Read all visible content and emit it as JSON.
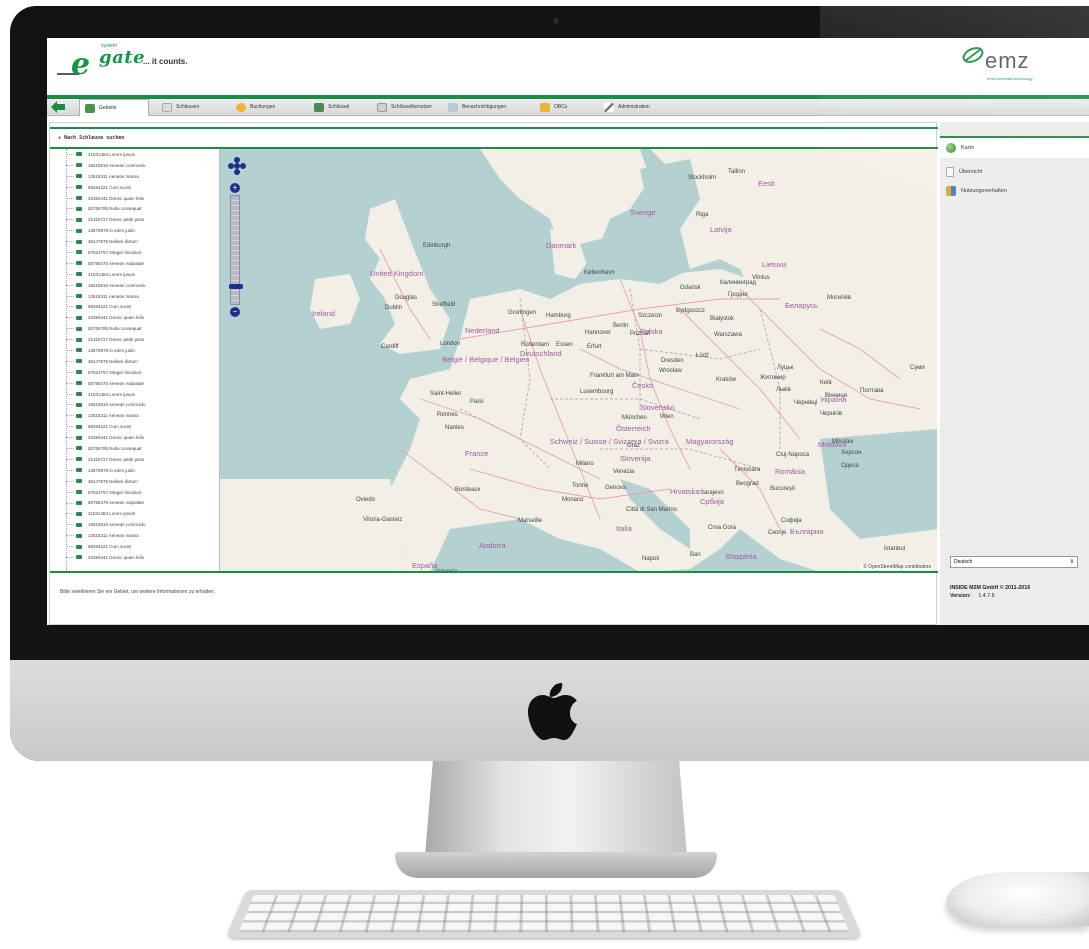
{
  "header": {
    "logo_left_prefix": "e",
    "logo_left_word": "gate",
    "logo_left_small": "system",
    "logo_left_tagline": "... it counts.",
    "logo_right": "emz",
    "logo_right_sub": "environmental technology"
  },
  "tabs": [
    {
      "label": "Gebiete",
      "icon": "map-icon",
      "active": true
    },
    {
      "label": "Schleusen",
      "icon": "gate-icon",
      "active": false
    },
    {
      "label": "Buchungen",
      "icon": "coins-icon",
      "active": false
    },
    {
      "label": "Schlüssel",
      "icon": "key-card-icon",
      "active": false
    },
    {
      "label": "Schlüsselbenutzer",
      "icon": "user-card-icon",
      "active": false
    },
    {
      "label": "Benachrichtigungen",
      "icon": "notification-icon",
      "active": false
    },
    {
      "label": "OBCs",
      "icon": "obc-icon",
      "active": false
    },
    {
      "label": "Administration",
      "icon": "wrench-icon",
      "active": false
    }
  ],
  "panel": {
    "title": "+ Nach Schleuse suchen",
    "status_message": "Bitte selektieren Sie ein Gebiet, um weitere Informationen zu erhalten."
  },
  "list": [
    "21531484 Lorem ipsum",
    "16515515 Aenean commodo",
    "13515311 Aenean massa",
    "89454221 Cum sociis",
    "34384441 Donec quam felis",
    "53755785 Nulla consequat",
    "21315727 Donec pede justo",
    "13575978 In enim justo",
    "35447875 Nullam dictum",
    "87524757 Integer tincidunt",
    "58785475 Aenean vulputate",
    "21531484 Lorem ipsum",
    "16515515 Aenean commodo",
    "13515311 Aenean massa",
    "89454221 Cum sociis",
    "34384441 Donec quam felis",
    "53755785 Nulla consequat",
    "21315727 Donec pede justo",
    "13575978 In enim justo",
    "35447875 Nullam dictum",
    "87524757 Integer tincidunt",
    "58785475 Aenean vulputate",
    "21531484 Lorem ipsum",
    "16515515 Aenean commodo",
    "13515311 Aenean massa",
    "89454221 Cum sociis",
    "34384441 Donec quam felis",
    "53755785 Nulla consequat",
    "21315727 Donec pede justo",
    "13575978 In enim justo",
    "35447875 Nullam dictum",
    "87524757 Integer tincidunt",
    "58785475 Aenean vulputate",
    "21531484 Lorem ipsum",
    "16515515 Aenean commodo",
    "13515311 Aenean massa",
    "89454221 Cum sociis",
    "34384441 Donec quam felis"
  ],
  "map": {
    "attribution": "© OpenStreetMap contributors",
    "countries": [
      {
        "name": "United Kingdom"
      },
      {
        "name": "Ireland"
      },
      {
        "name": "Danmark"
      },
      {
        "name": "Nederland"
      },
      {
        "name": "België / Belgique / Belgien"
      },
      {
        "name": "Deutschland"
      },
      {
        "name": "Polska"
      },
      {
        "name": "Česko"
      },
      {
        "name": "Slovensko"
      },
      {
        "name": "Österreich"
      },
      {
        "name": "Schweiz / Suisse / Svizzera / Svizra"
      },
      {
        "name": "France"
      },
      {
        "name": "Italia"
      },
      {
        "name": "Magyarország"
      },
      {
        "name": "România"
      },
      {
        "name": "Lietuva"
      },
      {
        "name": "Latvija"
      },
      {
        "name": "Eesti"
      },
      {
        "name": "Беларусь"
      },
      {
        "name": "Україна"
      },
      {
        "name": "Moldova"
      },
      {
        "name": "Slovenija"
      },
      {
        "name": "Hrvatska"
      },
      {
        "name": "Србија"
      },
      {
        "name": "България"
      },
      {
        "name": "Sverige"
      },
      {
        "name": "España"
      },
      {
        "name": "Shqipëria"
      },
      {
        "name": "Andorra"
      }
    ],
    "cities": [
      {
        "name": "Edinburgh"
      },
      {
        "name": "Douglas"
      },
      {
        "name": "Dublin"
      },
      {
        "name": "Sheffield"
      },
      {
        "name": "Cardiff"
      },
      {
        "name": "London"
      },
      {
        "name": "København"
      },
      {
        "name": "Hamburg"
      },
      {
        "name": "Groningen"
      },
      {
        "name": "Szczecin"
      },
      {
        "name": "Berlin"
      },
      {
        "name": "Poznań"
      },
      {
        "name": "Warszawa"
      },
      {
        "name": "Gdańsk"
      },
      {
        "name": "Калининград"
      },
      {
        "name": "Vilnius"
      },
      {
        "name": "Гродно"
      },
      {
        "name": "Białystok"
      },
      {
        "name": "Bydgoszcz"
      },
      {
        "name": "Łódź"
      },
      {
        "name": "Wrocław"
      },
      {
        "name": "Kraków"
      },
      {
        "name": "Hannover"
      },
      {
        "name": "Dresden"
      },
      {
        "name": "Erfurt"
      },
      {
        "name": "Rotterdam"
      },
      {
        "name": "Essen"
      },
      {
        "name": "Frankfurt am Main"
      },
      {
        "name": "Luxembourg"
      },
      {
        "name": "Paris"
      },
      {
        "name": "Saint-Helier"
      },
      {
        "name": "Rennes"
      },
      {
        "name": "Nantes"
      },
      {
        "name": "München"
      },
      {
        "name": "Wien"
      },
      {
        "name": "Graz"
      },
      {
        "name": "Bordeaux"
      },
      {
        "name": "Milano"
      },
      {
        "name": "Torino"
      },
      {
        "name": "Venezia"
      },
      {
        "name": "Genova"
      },
      {
        "name": "Monaco"
      },
      {
        "name": "Marseille"
      },
      {
        "name": "Oviedo"
      },
      {
        "name": "Vitoria-Gasteiz"
      },
      {
        "name": "Città di San Marino"
      },
      {
        "name": "Stockholm"
      },
      {
        "name": "Tallinn"
      },
      {
        "name": "Riga"
      },
      {
        "name": "Cluj-Napoca"
      },
      {
        "name": "Timișoara"
      },
      {
        "name": "Beograd"
      },
      {
        "name": "Sarajevo"
      },
      {
        "name": "Bucureşti"
      },
      {
        "name": "Софија"
      },
      {
        "name": "Скопје"
      },
      {
        "name": "Crna Gora"
      },
      {
        "name": "Bari"
      },
      {
        "name": "Napoli"
      },
      {
        "name": "Valencia"
      },
      {
        "name": "Львів"
      },
      {
        "name": "Луцьк"
      },
      {
        "name": "Житомир"
      },
      {
        "name": "Київ"
      },
      {
        "name": "Вінниця"
      },
      {
        "name": "Полтава"
      },
      {
        "name": "Суми"
      },
      {
        "name": "Чернігів"
      },
      {
        "name": "Могилёв"
      },
      {
        "name": "Mikolaiv"
      },
      {
        "name": "Херсон"
      },
      {
        "name": "Одеса"
      },
      {
        "name": "İstanbul"
      },
      {
        "name": "Чернівці"
      }
    ]
  },
  "sidebar": {
    "items": [
      {
        "label": "Karte",
        "icon": "globe-icon",
        "active": true
      },
      {
        "label": "Übersicht",
        "icon": "document-icon",
        "active": false
      },
      {
        "label": "Nutzungsverhalten",
        "icon": "users-chart-icon",
        "active": false
      }
    ],
    "language": "Deutsch",
    "footer_line1": "INSIDE M2M GmbH © 2011-2016",
    "version_label": "Version:",
    "version_value": "1.4.7.6"
  },
  "colors": {
    "accent": "#1b8c45",
    "zoom_control": "#1c2f8a",
    "map_water": "#b5d0d0",
    "map_land": "#f2efe6"
  }
}
